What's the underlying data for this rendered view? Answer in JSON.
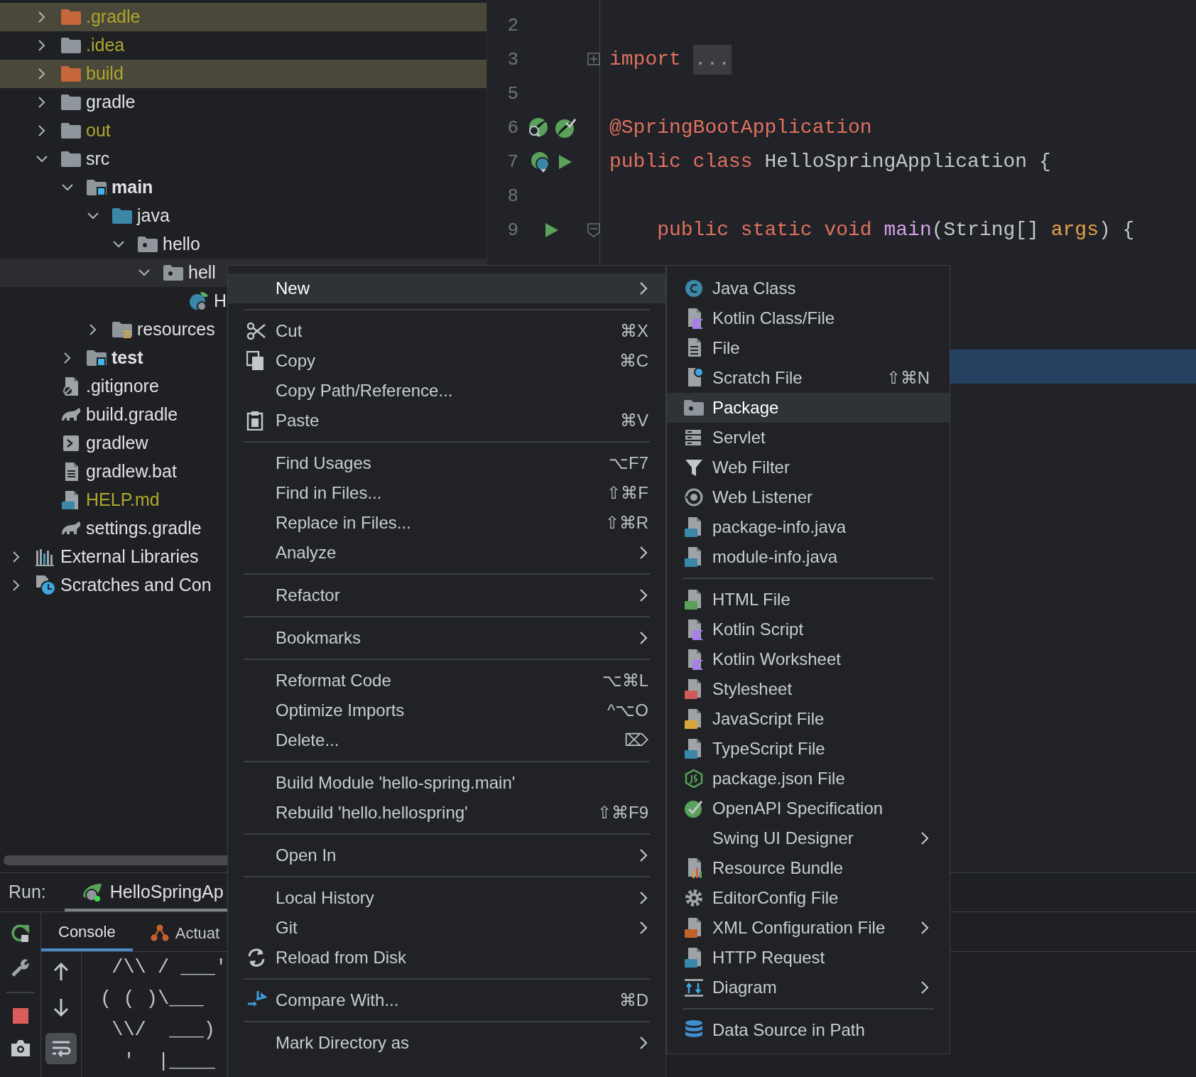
{
  "project_tree": {
    "module_items": [
      {
        "label": ".gradle",
        "kind": "folder",
        "excluded": true,
        "ignored": true,
        "expanded": false,
        "selected": false
      },
      {
        "label": ".idea",
        "kind": "folder",
        "excluded": false,
        "ignored": true,
        "expanded": false,
        "selected": false
      },
      {
        "label": "build",
        "kind": "folder",
        "excluded": true,
        "ignored": true,
        "expanded": false,
        "selected": false
      },
      {
        "label": "gradle",
        "kind": "folder",
        "excluded": false,
        "ignored": false,
        "expanded": false,
        "selected": false
      },
      {
        "label": "out",
        "kind": "folder",
        "excluded": false,
        "ignored": true,
        "expanded": false,
        "selected": false
      },
      {
        "label": "src",
        "kind": "folder",
        "excluded": false,
        "ignored": false,
        "expanded": true,
        "selected": false,
        "children": [
          {
            "label": "main",
            "kind": "module",
            "excluded": false,
            "ignored": false,
            "expanded": true,
            "selected": false,
            "children": [
              {
                "label": "java",
                "kind": "source-root",
                "excluded": false,
                "ignored": false,
                "expanded": true,
                "selected": false,
                "children": [
                  {
                    "label": "hello",
                    "kind": "package",
                    "excluded": false,
                    "ignored": false,
                    "expanded": true,
                    "selected": false,
                    "children": [
                      {
                        "label": "hell",
                        "kind": "package",
                        "excluded": false,
                        "ignored": false,
                        "expanded": true,
                        "selected": true,
                        "children": [
                          {
                            "label": "H",
                            "kind": "spring-class",
                            "excluded": false,
                            "ignored": false,
                            "selected": false
                          }
                        ]
                      }
                    ]
                  }
                ]
              },
              {
                "label": "resources",
                "kind": "resource-root",
                "excluded": false,
                "ignored": false,
                "expanded": false,
                "selected": false
              }
            ]
          },
          {
            "label": "test",
            "kind": "module",
            "excluded": false,
            "ignored": false,
            "expanded": false,
            "selected": false
          }
        ]
      },
      {
        "label": ".gitignore",
        "kind": "ignore-file",
        "excluded": false,
        "ignored": false,
        "selected": false
      },
      {
        "label": "build.gradle",
        "kind": "gradle-file",
        "excluded": false,
        "ignored": false,
        "selected": false
      },
      {
        "label": "gradlew",
        "kind": "script",
        "excluded": false,
        "ignored": false,
        "selected": false
      },
      {
        "label": "gradlew.bat",
        "kind": "text-file",
        "excluded": false,
        "ignored": false,
        "selected": false
      },
      {
        "label": "HELP.md",
        "kind": "markdown",
        "excluded": false,
        "ignored": true,
        "selected": false
      },
      {
        "label": "settings.gradle",
        "kind": "gradle-file",
        "excluded": false,
        "ignored": false,
        "selected": false
      }
    ],
    "root_items": [
      {
        "label": "External Libraries",
        "kind": "libraries",
        "excluded": false,
        "ignored": false,
        "expanded": false,
        "selected": false
      },
      {
        "label": "Scratches and Con",
        "kind": "scratches",
        "excluded": false,
        "ignored": false,
        "expanded": false,
        "selected": false
      }
    ]
  },
  "editor": {
    "lines": [
      {
        "number": "2"
      },
      {
        "number": "3",
        "folded": true,
        "tokens": [
          {
            "text": "import ",
            "kind": "keyword"
          },
          {
            "text": "...",
            "kind": "folded"
          }
        ]
      },
      {
        "number": "5"
      },
      {
        "number": "6",
        "tokens": [
          {
            "text": "@SpringBootApplication",
            "kind": "annotation"
          }
        ]
      },
      {
        "number": "7",
        "run": true,
        "tokens": [
          {
            "text": "public class ",
            "kind": "keyword"
          },
          {
            "text": "HelloSpringApplication {",
            "kind": "plain"
          }
        ]
      },
      {
        "number": "8"
      },
      {
        "number": "9",
        "run": true,
        "folded": false,
        "tokens": [
          {
            "text": "    public static void ",
            "kind": "keyword"
          },
          {
            "text": "main",
            "kind": "method"
          },
          {
            "text": "(String[] ",
            "kind": "plain"
          },
          {
            "text": "args",
            "kind": "param"
          },
          {
            "text": ") {",
            "kind": "plain"
          }
        ]
      }
    ],
    "caret_row": {
      "selected": true
    }
  },
  "run_panel": {
    "label": "Run:",
    "config_tab": {
      "label": "HelloSpringAp",
      "selected": true
    },
    "tabs": [
      {
        "label": "Console",
        "selected": true
      },
      {
        "label": "Actuat",
        "selected": false
      }
    ],
    "console_lines": [
      " /\\\\ / ___'",
      "( ( )\\___",
      " \\\\/  ___)",
      "  '  |____"
    ]
  },
  "context_menu": {
    "groups": [
      [
        {
          "label": "New",
          "submenu": true,
          "selected": true
        }
      ],
      [
        {
          "label": "Cut",
          "shortcut": "⌘X",
          "submenu": false,
          "selected": false
        },
        {
          "label": "Copy",
          "shortcut": "⌘C",
          "submenu": false,
          "selected": false
        },
        {
          "label": "Copy Path/Reference...",
          "submenu": false,
          "selected": false
        },
        {
          "label": "Paste",
          "shortcut": "⌘V",
          "submenu": false,
          "selected": false
        }
      ],
      [
        {
          "label": "Find Usages",
          "shortcut": "⌥F7",
          "submenu": false,
          "selected": false
        },
        {
          "label": "Find in Files...",
          "shortcut": "⇧⌘F",
          "submenu": false,
          "selected": false
        },
        {
          "label": "Replace in Files...",
          "shortcut": "⇧⌘R",
          "submenu": false,
          "selected": false
        },
        {
          "label": "Analyze",
          "submenu": true,
          "selected": false
        }
      ],
      [
        {
          "label": "Refactor",
          "submenu": true,
          "selected": false
        }
      ],
      [
        {
          "label": "Bookmarks",
          "submenu": true,
          "selected": false
        }
      ],
      [
        {
          "label": "Reformat Code",
          "shortcut": "⌥⌘L",
          "submenu": false,
          "selected": false
        },
        {
          "label": "Optimize Imports",
          "shortcut": "^⌥O",
          "submenu": false,
          "selected": false
        },
        {
          "label": "Delete...",
          "shortcut": "⌦",
          "submenu": false,
          "selected": false
        }
      ],
      [
        {
          "label": "Build Module 'hello-spring.main'",
          "submenu": false,
          "selected": false
        },
        {
          "label": "Rebuild 'hello.hellospring'",
          "shortcut": "⇧⌘F9",
          "submenu": false,
          "selected": false
        }
      ],
      [
        {
          "label": "Open In",
          "submenu": true,
          "selected": false
        }
      ],
      [
        {
          "label": "Local History",
          "submenu": true,
          "selected": false
        },
        {
          "label": "Git",
          "submenu": true,
          "selected": false
        },
        {
          "label": "Reload from Disk",
          "submenu": false,
          "selected": false
        }
      ],
      [
        {
          "label": "Compare With...",
          "shortcut": "⌘D",
          "submenu": false,
          "selected": false
        }
      ],
      [
        {
          "label": "Mark Directory as",
          "submenu": true,
          "selected": false
        }
      ]
    ]
  },
  "new_submenu": {
    "groups": [
      [
        {
          "label": "Java Class",
          "submenu": false,
          "selected": false
        },
        {
          "label": "Kotlin Class/File",
          "submenu": false,
          "selected": false
        },
        {
          "label": "File",
          "submenu": false,
          "selected": false
        },
        {
          "label": "Scratch File",
          "shortcut": "⇧⌘N",
          "submenu": false,
          "selected": false
        },
        {
          "label": "Package",
          "submenu": false,
          "selected": true
        },
        {
          "label": "Servlet",
          "submenu": false,
          "selected": false
        },
        {
          "label": "Web Filter",
          "submenu": false,
          "selected": false
        },
        {
          "label": "Web Listener",
          "submenu": false,
          "selected": false
        },
        {
          "label": "package-info.java",
          "submenu": false,
          "selected": false
        },
        {
          "label": "module-info.java",
          "submenu": false,
          "selected": false
        }
      ],
      [
        {
          "label": "HTML File",
          "submenu": false,
          "selected": false
        },
        {
          "label": "Kotlin Script",
          "submenu": false,
          "selected": false
        },
        {
          "label": "Kotlin Worksheet",
          "submenu": false,
          "selected": false
        },
        {
          "label": "Stylesheet",
          "submenu": false,
          "selected": false
        },
        {
          "label": "JavaScript File",
          "submenu": false,
          "selected": false
        },
        {
          "label": "TypeScript File",
          "submenu": false,
          "selected": false
        },
        {
          "label": "package.json File",
          "submenu": false,
          "selected": false
        },
        {
          "label": "OpenAPI Specification",
          "submenu": false,
          "selected": false
        },
        {
          "label": "Swing UI Designer",
          "submenu": true,
          "selected": false
        },
        {
          "label": "Resource Bundle",
          "submenu": false,
          "selected": false
        },
        {
          "label": "EditorConfig File",
          "submenu": false,
          "selected": false
        },
        {
          "label": "XML Configuration File",
          "submenu": true,
          "selected": false
        },
        {
          "label": "HTTP Request",
          "submenu": false,
          "selected": false
        },
        {
          "label": "Diagram",
          "submenu": true,
          "selected": false
        }
      ],
      [
        {
          "label": "Data Source in Path",
          "submenu": false,
          "selected": false
        }
      ]
    ]
  }
}
